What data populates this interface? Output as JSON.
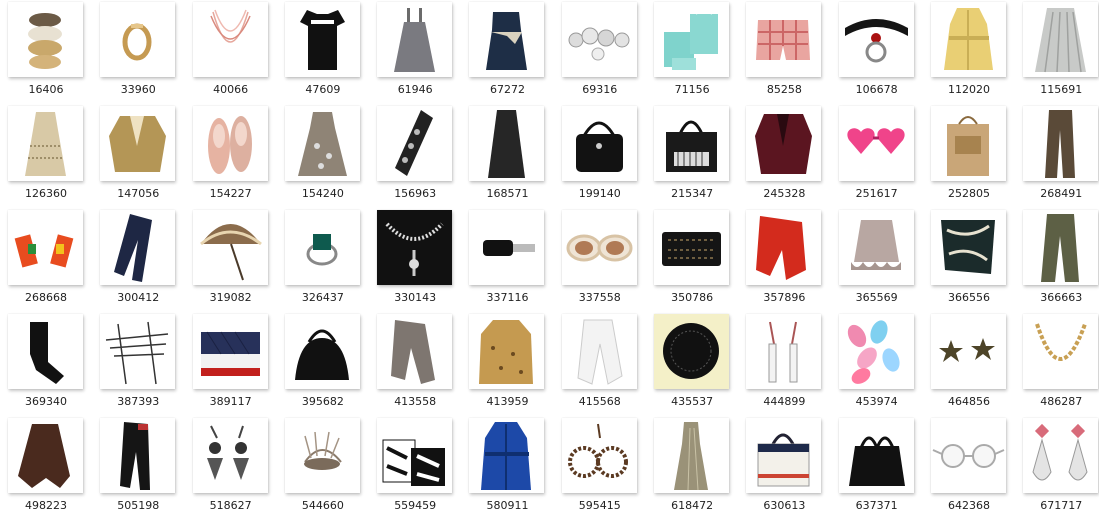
{
  "gallery": {
    "items": [
      {
        "id": "16406",
        "icon": "bangle-bracelets-icon"
      },
      {
        "id": "33960",
        "icon": "gold-ring-icon"
      },
      {
        "id": "40066",
        "icon": "beaded-necklace-icon"
      },
      {
        "id": "47609",
        "icon": "black-top-icon"
      },
      {
        "id": "61946",
        "icon": "grey-pinafore-dress-icon"
      },
      {
        "id": "67272",
        "icon": "navy-strapless-dress-icon"
      },
      {
        "id": "69316",
        "icon": "crystal-beads-icon"
      },
      {
        "id": "71156",
        "icon": "turquoise-gift-bags-icon"
      },
      {
        "id": "85258",
        "icon": "plaid-shorts-icon"
      },
      {
        "id": "106678",
        "icon": "black-collar-icon"
      },
      {
        "id": "112020",
        "icon": "yellow-trench-coat-icon"
      },
      {
        "id": "115691",
        "icon": "pleated-skirt-icon"
      },
      {
        "id": "126360",
        "icon": "beaded-dress-icon"
      },
      {
        "id": "147056",
        "icon": "gold-jacket-icon"
      },
      {
        "id": "154227",
        "icon": "pink-ballet-flats-icon"
      },
      {
        "id": "154240",
        "icon": "printed-dress-icon"
      },
      {
        "id": "156963",
        "icon": "embellished-glove-icon"
      },
      {
        "id": "168571",
        "icon": "black-maxi-skirt-icon"
      },
      {
        "id": "199140",
        "icon": "black-handbag-icon"
      },
      {
        "id": "215347",
        "icon": "black-tote-icon"
      },
      {
        "id": "245328",
        "icon": "burgundy-blazer-icon"
      },
      {
        "id": "251617",
        "icon": "pink-heart-sunglasses-icon"
      },
      {
        "id": "252805",
        "icon": "brown-paper-bag-icon"
      },
      {
        "id": "268491",
        "icon": "brown-trousers-icon"
      },
      {
        "id": "268668",
        "icon": "colorful-earrings-icon"
      },
      {
        "id": "300412",
        "icon": "navy-jeans-icon"
      },
      {
        "id": "319082",
        "icon": "parasol-umbrella-icon"
      },
      {
        "id": "326437",
        "icon": "emerald-ring-icon"
      },
      {
        "id": "330143",
        "icon": "statement-necklace-icon"
      },
      {
        "id": "337116",
        "icon": "car-key-icon"
      },
      {
        "id": "337558",
        "icon": "white-sunglasses-icon"
      },
      {
        "id": "350786",
        "icon": "black-clutch-icon"
      },
      {
        "id": "357896",
        "icon": "red-trousers-icon"
      },
      {
        "id": "365569",
        "icon": "ruffle-skirt-icon"
      },
      {
        "id": "366556",
        "icon": "silk-scarf-icon"
      },
      {
        "id": "366663",
        "icon": "olive-trousers-icon"
      },
      {
        "id": "369340",
        "icon": "black-tights-icon"
      },
      {
        "id": "387393",
        "icon": "hair-pins-icon"
      },
      {
        "id": "389117",
        "icon": "quilted-bag-icon"
      },
      {
        "id": "395682",
        "icon": "black-alma-bag-icon"
      },
      {
        "id": "413558",
        "icon": "grey-trousers-icon"
      },
      {
        "id": "413959",
        "icon": "leopard-coat-icon"
      },
      {
        "id": "415568",
        "icon": "white-jeans-icon"
      },
      {
        "id": "435537",
        "icon": "black-lace-umbrella-icon"
      },
      {
        "id": "444899",
        "icon": "drop-earrings-icon"
      },
      {
        "id": "453974",
        "icon": "flip-flops-icon"
      },
      {
        "id": "464856",
        "icon": "star-earrings-icon"
      },
      {
        "id": "486287",
        "icon": "gold-chain-necklace-icon"
      },
      {
        "id": "498223",
        "icon": "brown-skirt-icon"
      },
      {
        "id": "505198",
        "icon": "black-jeans-icon"
      },
      {
        "id": "518627",
        "icon": "chandelier-earrings-icon"
      },
      {
        "id": "544660",
        "icon": "feather-fascinator-icon"
      },
      {
        "id": "559459",
        "icon": "patterned-shopping-bags-icon"
      },
      {
        "id": "580911",
        "icon": "blue-trench-coat-icon"
      },
      {
        "id": "595415",
        "icon": "wood-bead-bracelet-icon"
      },
      {
        "id": "618472",
        "icon": "metallic-gown-icon"
      },
      {
        "id": "630613",
        "icon": "canvas-tote-icon"
      },
      {
        "id": "637371",
        "icon": "black-birkin-bag-icon"
      },
      {
        "id": "642368",
        "icon": "round-glasses-icon"
      },
      {
        "id": "671717",
        "icon": "crystal-drop-earrings-icon"
      }
    ]
  }
}
